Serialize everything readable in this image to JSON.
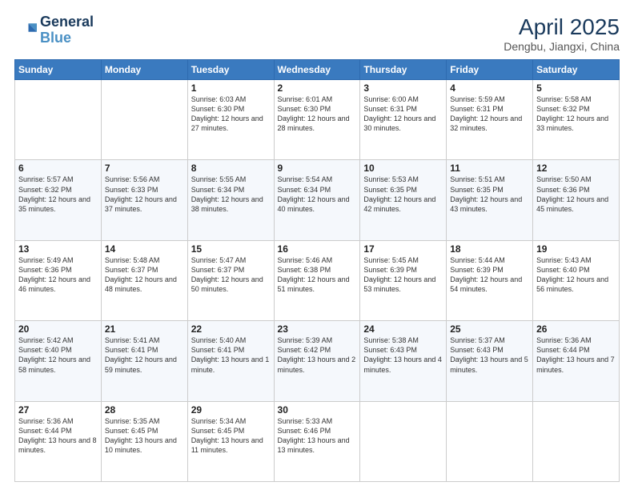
{
  "logo": {
    "line1": "General",
    "line2": "Blue"
  },
  "title": "April 2025",
  "subtitle": "Dengbu, Jiangxi, China",
  "headers": [
    "Sunday",
    "Monday",
    "Tuesday",
    "Wednesday",
    "Thursday",
    "Friday",
    "Saturday"
  ],
  "weeks": [
    [
      {
        "day": "",
        "info": ""
      },
      {
        "day": "",
        "info": ""
      },
      {
        "day": "1",
        "info": "Sunrise: 6:03 AM\nSunset: 6:30 PM\nDaylight: 12 hours and 27 minutes."
      },
      {
        "day": "2",
        "info": "Sunrise: 6:01 AM\nSunset: 6:30 PM\nDaylight: 12 hours and 28 minutes."
      },
      {
        "day": "3",
        "info": "Sunrise: 6:00 AM\nSunset: 6:31 PM\nDaylight: 12 hours and 30 minutes."
      },
      {
        "day": "4",
        "info": "Sunrise: 5:59 AM\nSunset: 6:31 PM\nDaylight: 12 hours and 32 minutes."
      },
      {
        "day": "5",
        "info": "Sunrise: 5:58 AM\nSunset: 6:32 PM\nDaylight: 12 hours and 33 minutes."
      }
    ],
    [
      {
        "day": "6",
        "info": "Sunrise: 5:57 AM\nSunset: 6:32 PM\nDaylight: 12 hours and 35 minutes."
      },
      {
        "day": "7",
        "info": "Sunrise: 5:56 AM\nSunset: 6:33 PM\nDaylight: 12 hours and 37 minutes."
      },
      {
        "day": "8",
        "info": "Sunrise: 5:55 AM\nSunset: 6:34 PM\nDaylight: 12 hours and 38 minutes."
      },
      {
        "day": "9",
        "info": "Sunrise: 5:54 AM\nSunset: 6:34 PM\nDaylight: 12 hours and 40 minutes."
      },
      {
        "day": "10",
        "info": "Sunrise: 5:53 AM\nSunset: 6:35 PM\nDaylight: 12 hours and 42 minutes."
      },
      {
        "day": "11",
        "info": "Sunrise: 5:51 AM\nSunset: 6:35 PM\nDaylight: 12 hours and 43 minutes."
      },
      {
        "day": "12",
        "info": "Sunrise: 5:50 AM\nSunset: 6:36 PM\nDaylight: 12 hours and 45 minutes."
      }
    ],
    [
      {
        "day": "13",
        "info": "Sunrise: 5:49 AM\nSunset: 6:36 PM\nDaylight: 12 hours and 46 minutes."
      },
      {
        "day": "14",
        "info": "Sunrise: 5:48 AM\nSunset: 6:37 PM\nDaylight: 12 hours and 48 minutes."
      },
      {
        "day": "15",
        "info": "Sunrise: 5:47 AM\nSunset: 6:37 PM\nDaylight: 12 hours and 50 minutes."
      },
      {
        "day": "16",
        "info": "Sunrise: 5:46 AM\nSunset: 6:38 PM\nDaylight: 12 hours and 51 minutes."
      },
      {
        "day": "17",
        "info": "Sunrise: 5:45 AM\nSunset: 6:39 PM\nDaylight: 12 hours and 53 minutes."
      },
      {
        "day": "18",
        "info": "Sunrise: 5:44 AM\nSunset: 6:39 PM\nDaylight: 12 hours and 54 minutes."
      },
      {
        "day": "19",
        "info": "Sunrise: 5:43 AM\nSunset: 6:40 PM\nDaylight: 12 hours and 56 minutes."
      }
    ],
    [
      {
        "day": "20",
        "info": "Sunrise: 5:42 AM\nSunset: 6:40 PM\nDaylight: 12 hours and 58 minutes."
      },
      {
        "day": "21",
        "info": "Sunrise: 5:41 AM\nSunset: 6:41 PM\nDaylight: 12 hours and 59 minutes."
      },
      {
        "day": "22",
        "info": "Sunrise: 5:40 AM\nSunset: 6:41 PM\nDaylight: 13 hours and 1 minute."
      },
      {
        "day": "23",
        "info": "Sunrise: 5:39 AM\nSunset: 6:42 PM\nDaylight: 13 hours and 2 minutes."
      },
      {
        "day": "24",
        "info": "Sunrise: 5:38 AM\nSunset: 6:43 PM\nDaylight: 13 hours and 4 minutes."
      },
      {
        "day": "25",
        "info": "Sunrise: 5:37 AM\nSunset: 6:43 PM\nDaylight: 13 hours and 5 minutes."
      },
      {
        "day": "26",
        "info": "Sunrise: 5:36 AM\nSunset: 6:44 PM\nDaylight: 13 hours and 7 minutes."
      }
    ],
    [
      {
        "day": "27",
        "info": "Sunrise: 5:36 AM\nSunset: 6:44 PM\nDaylight: 13 hours and 8 minutes."
      },
      {
        "day": "28",
        "info": "Sunrise: 5:35 AM\nSunset: 6:45 PM\nDaylight: 13 hours and 10 minutes."
      },
      {
        "day": "29",
        "info": "Sunrise: 5:34 AM\nSunset: 6:45 PM\nDaylight: 13 hours and 11 minutes."
      },
      {
        "day": "30",
        "info": "Sunrise: 5:33 AM\nSunset: 6:46 PM\nDaylight: 13 hours and 13 minutes."
      },
      {
        "day": "",
        "info": ""
      },
      {
        "day": "",
        "info": ""
      },
      {
        "day": "",
        "info": ""
      }
    ]
  ]
}
